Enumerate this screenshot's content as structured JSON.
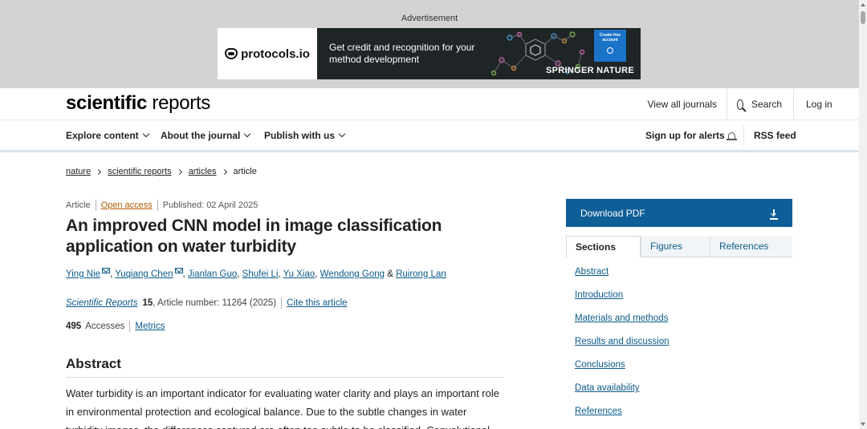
{
  "ad": {
    "label": "Advertisement",
    "logo_text": "protocols.io",
    "message": "Get credit and recognition for your method development",
    "cta": "Create free account",
    "brand": "SPRINGER NATURE"
  },
  "header": {
    "brand_bold": "scientific",
    "brand_light": " reports",
    "view_all_journals": "View all journals",
    "search": "Search",
    "login": "Log in"
  },
  "nav": {
    "explore": "Explore content",
    "about": "About the journal",
    "publish": "Publish with us",
    "alerts": "Sign up for alerts",
    "rss": "RSS feed"
  },
  "breadcrumb": [
    "nature",
    "scientific reports",
    "articles",
    "article"
  ],
  "article": {
    "type": "Article",
    "access": "Open access",
    "published": "Published: 02 April 2025",
    "title": "An improved CNN model in image classification application on water turbidity",
    "authors": [
      "Ying Nie",
      "Yuqiang Chen",
      "Jianlan Guo",
      "Shufei Li",
      "Yu Xiao",
      "Wendong Gong",
      "Ruirong Lan"
    ],
    "journal": "Scientific Reports",
    "volume": "15",
    "article_number": ", Article number: 11264 (2025)",
    "cite": "Cite this article",
    "accesses_count": "495",
    "accesses_label": "Accesses",
    "metrics": "Metrics",
    "abstract_heading": "Abstract",
    "abstract_text": "Water turbidity is an important indicator for evaluating water clarity and plays an important role in environmental protection and ecological balance. Due to the subtle changes in water turbidity images, the differences captured are often too subtle to be classified. Convolutional"
  },
  "sidebar": {
    "download_pdf": "Download PDF",
    "tabs": [
      "Sections",
      "Figures",
      "References"
    ],
    "sections": [
      "Abstract",
      "Introduction",
      "Materials and methods",
      "Results and discussion",
      "Conclusions",
      "Data availability",
      "References"
    ]
  },
  "colors": {
    "primary_blue": "#0e5e97",
    "link_blue": "#0b5a8a",
    "open_access": "#b35c00",
    "ad_background": "#d3d3d3"
  }
}
